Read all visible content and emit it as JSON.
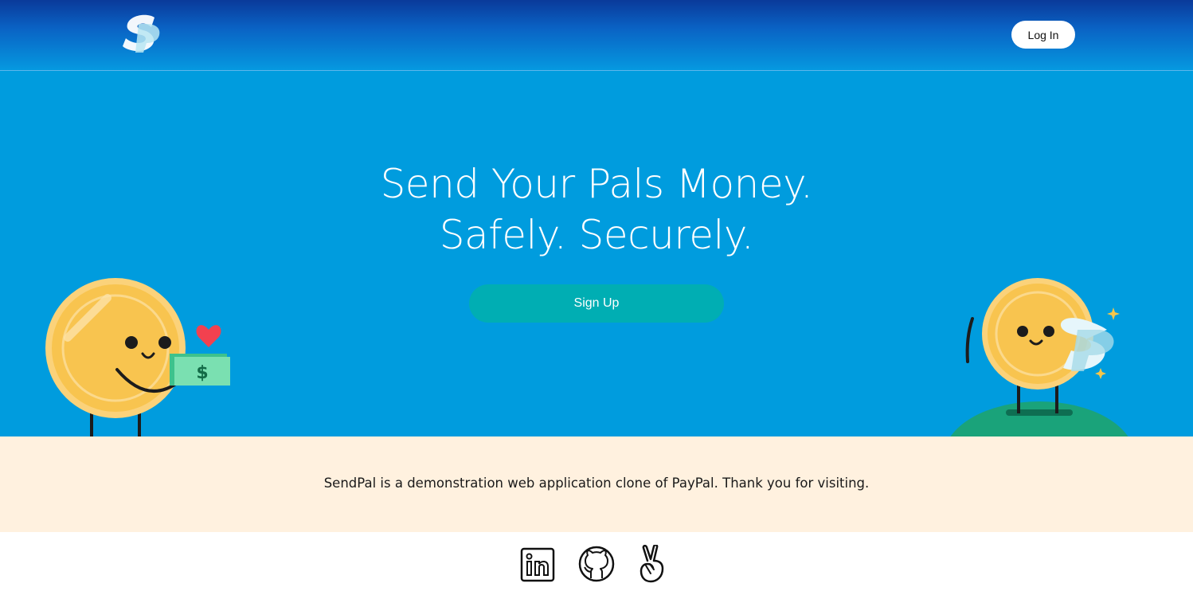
{
  "header": {
    "logo_icon": "sendpal-logo-icon",
    "login_label": "Log In"
  },
  "hero": {
    "headline_line1": "Send Your Pals Money.",
    "headline_line2": "Safely. Securely.",
    "signup_label": "Sign Up",
    "illustrations": [
      "coin-character-with-cash-icon",
      "coin-character-with-logo-icon"
    ]
  },
  "about": {
    "text": "SendPal is a demonstration web application clone of PayPal. Thank you for visiting."
  },
  "footer": {
    "links": [
      "linkedin-icon",
      "github-icon",
      "angellist-icon"
    ]
  },
  "colors": {
    "header_top": "#0a3a9a",
    "hero_bg": "#009cde",
    "signup_bg": "#00aeb3",
    "about_bg": "#fff1df",
    "coin": "#f8c44f"
  }
}
